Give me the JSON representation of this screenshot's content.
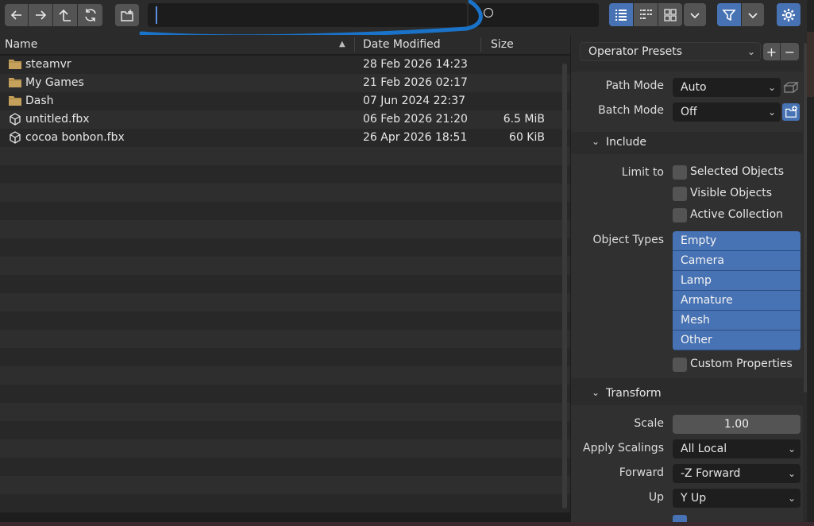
{
  "toolbar": {
    "back_icon": "arrow-left-icon",
    "forward_icon": "arrow-right-icon",
    "parent_icon": "parent-directory-icon",
    "refresh_icon": "refresh-icon",
    "new_folder_icon": "new-folder-icon",
    "path_value": "",
    "filename_value": "",
    "filter_icon": "filter-icon",
    "settings_icon": "gear-icon",
    "active_view": "vertical-list"
  },
  "file_list": {
    "columns": {
      "name": "Name",
      "date": "Date Modified",
      "size": "Size"
    },
    "sort_indicator": "▲",
    "files": [
      {
        "name": "steamvr",
        "date": "28 Feb 2026 14:23",
        "size": "",
        "icon": "folder-icon"
      },
      {
        "name": "My Games",
        "date": "21 Feb 2026 02:17",
        "size": "",
        "icon": "folder-icon"
      },
      {
        "name": "Dash",
        "date": "07 Jun 2024 22:37",
        "size": "",
        "icon": "folder-icon"
      },
      {
        "name": "untitled.fbx",
        "date": "06 Feb 2026 21:20",
        "size": "6.5 MiB",
        "icon": "cube-icon"
      },
      {
        "name": "cocoa bonbon.fbx",
        "date": "26 Apr 2026 18:51",
        "size": "60 KiB",
        "icon": "cube-icon"
      }
    ]
  },
  "panel": {
    "operator_presets": "Operator Presets",
    "path_mode": {
      "label": "Path Mode",
      "value": "Auto"
    },
    "batch_mode": {
      "label": "Batch Mode",
      "value": "Off"
    },
    "include": {
      "title": "Include",
      "limit_to_label": "Limit to",
      "limit_options": [
        "Selected Objects",
        "Visible Objects",
        "Active Collection"
      ],
      "object_types_label": "Object Types",
      "object_types": [
        "Empty",
        "Camera",
        "Lamp",
        "Armature",
        "Mesh",
        "Other"
      ],
      "custom_properties": "Custom Properties"
    },
    "transform": {
      "title": "Transform",
      "scale_label": "Scale",
      "scale_value": "1.00",
      "apply_scalings_label": "Apply Scalings",
      "apply_scalings_value": "All Local",
      "forward_label": "Forward",
      "forward_value": "-Z Forward",
      "up_label": "Up",
      "up_value": "Y Up"
    }
  },
  "colors": {
    "accent": "#4772b3",
    "annotation_stroke": "#1a73c8",
    "folder": "#c6a15b"
  }
}
